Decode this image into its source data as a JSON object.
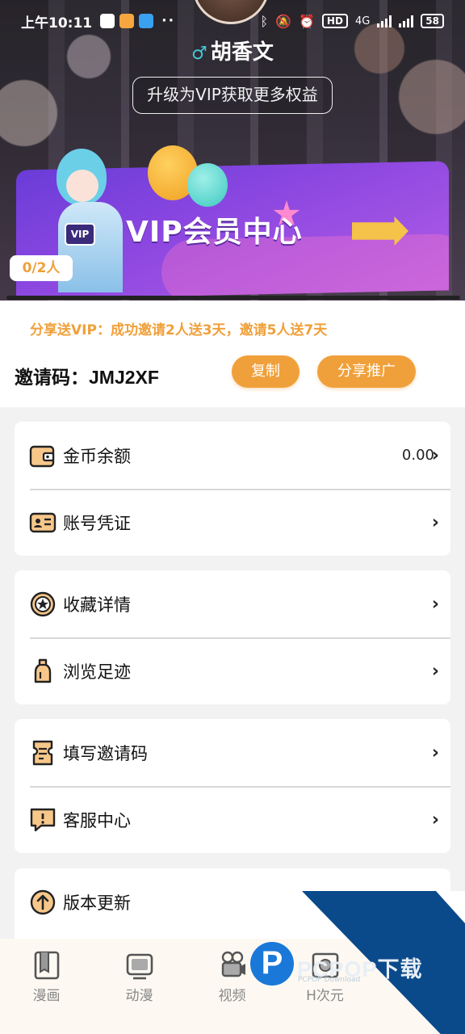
{
  "status_bar": {
    "time": "上午10:11",
    "network": "4G",
    "hd": "HD",
    "battery": "58"
  },
  "profile": {
    "gender_icon": "male-symbol",
    "username": "胡香文",
    "vip_upgrade_label": "升级为VIP获取更多权益"
  },
  "banner": {
    "title": "VIP会员中心",
    "badge_text": "VIP",
    "invite_count": "0/2人"
  },
  "invite": {
    "promo_text": "分享送VIP：成功邀请2人送3天，邀请5人送7天",
    "code_label": "邀请码：",
    "code_value": "JMJ2XF",
    "copy_label": "复制",
    "share_label": "分享推广"
  },
  "menu": {
    "card1": [
      {
        "label": "金币余额",
        "value": "0.00",
        "icon": "wallet-icon"
      },
      {
        "label": "账号凭证",
        "icon": "id-card-icon"
      }
    ],
    "card2": [
      {
        "label": "收藏详情",
        "icon": "star-badge-icon"
      },
      {
        "label": "浏览足迹",
        "icon": "bottle-icon"
      }
    ],
    "card3": [
      {
        "label": "填写邀请码",
        "icon": "ticket-icon"
      },
      {
        "label": "客服中心",
        "icon": "message-alert-icon"
      }
    ],
    "card4": [
      {
        "label": "版本更新",
        "icon": "upload-arrow-icon"
      }
    ]
  },
  "tabbar": [
    {
      "label": "漫画",
      "icon": "comic-book-icon"
    },
    {
      "label": "动漫",
      "icon": "tv-icon"
    },
    {
      "label": "视频",
      "icon": "video-camera-icon"
    },
    {
      "label": "H次元",
      "icon": "photo-icon"
    }
  ],
  "watermark": {
    "logo_letter": "P",
    "text": "PCPOP下载",
    "sub": "PCPOP Download"
  },
  "colors": {
    "accent": "#f0a03a",
    "banner_purple": "#7a40dc",
    "watermark_blue": "#0a4a8a"
  }
}
